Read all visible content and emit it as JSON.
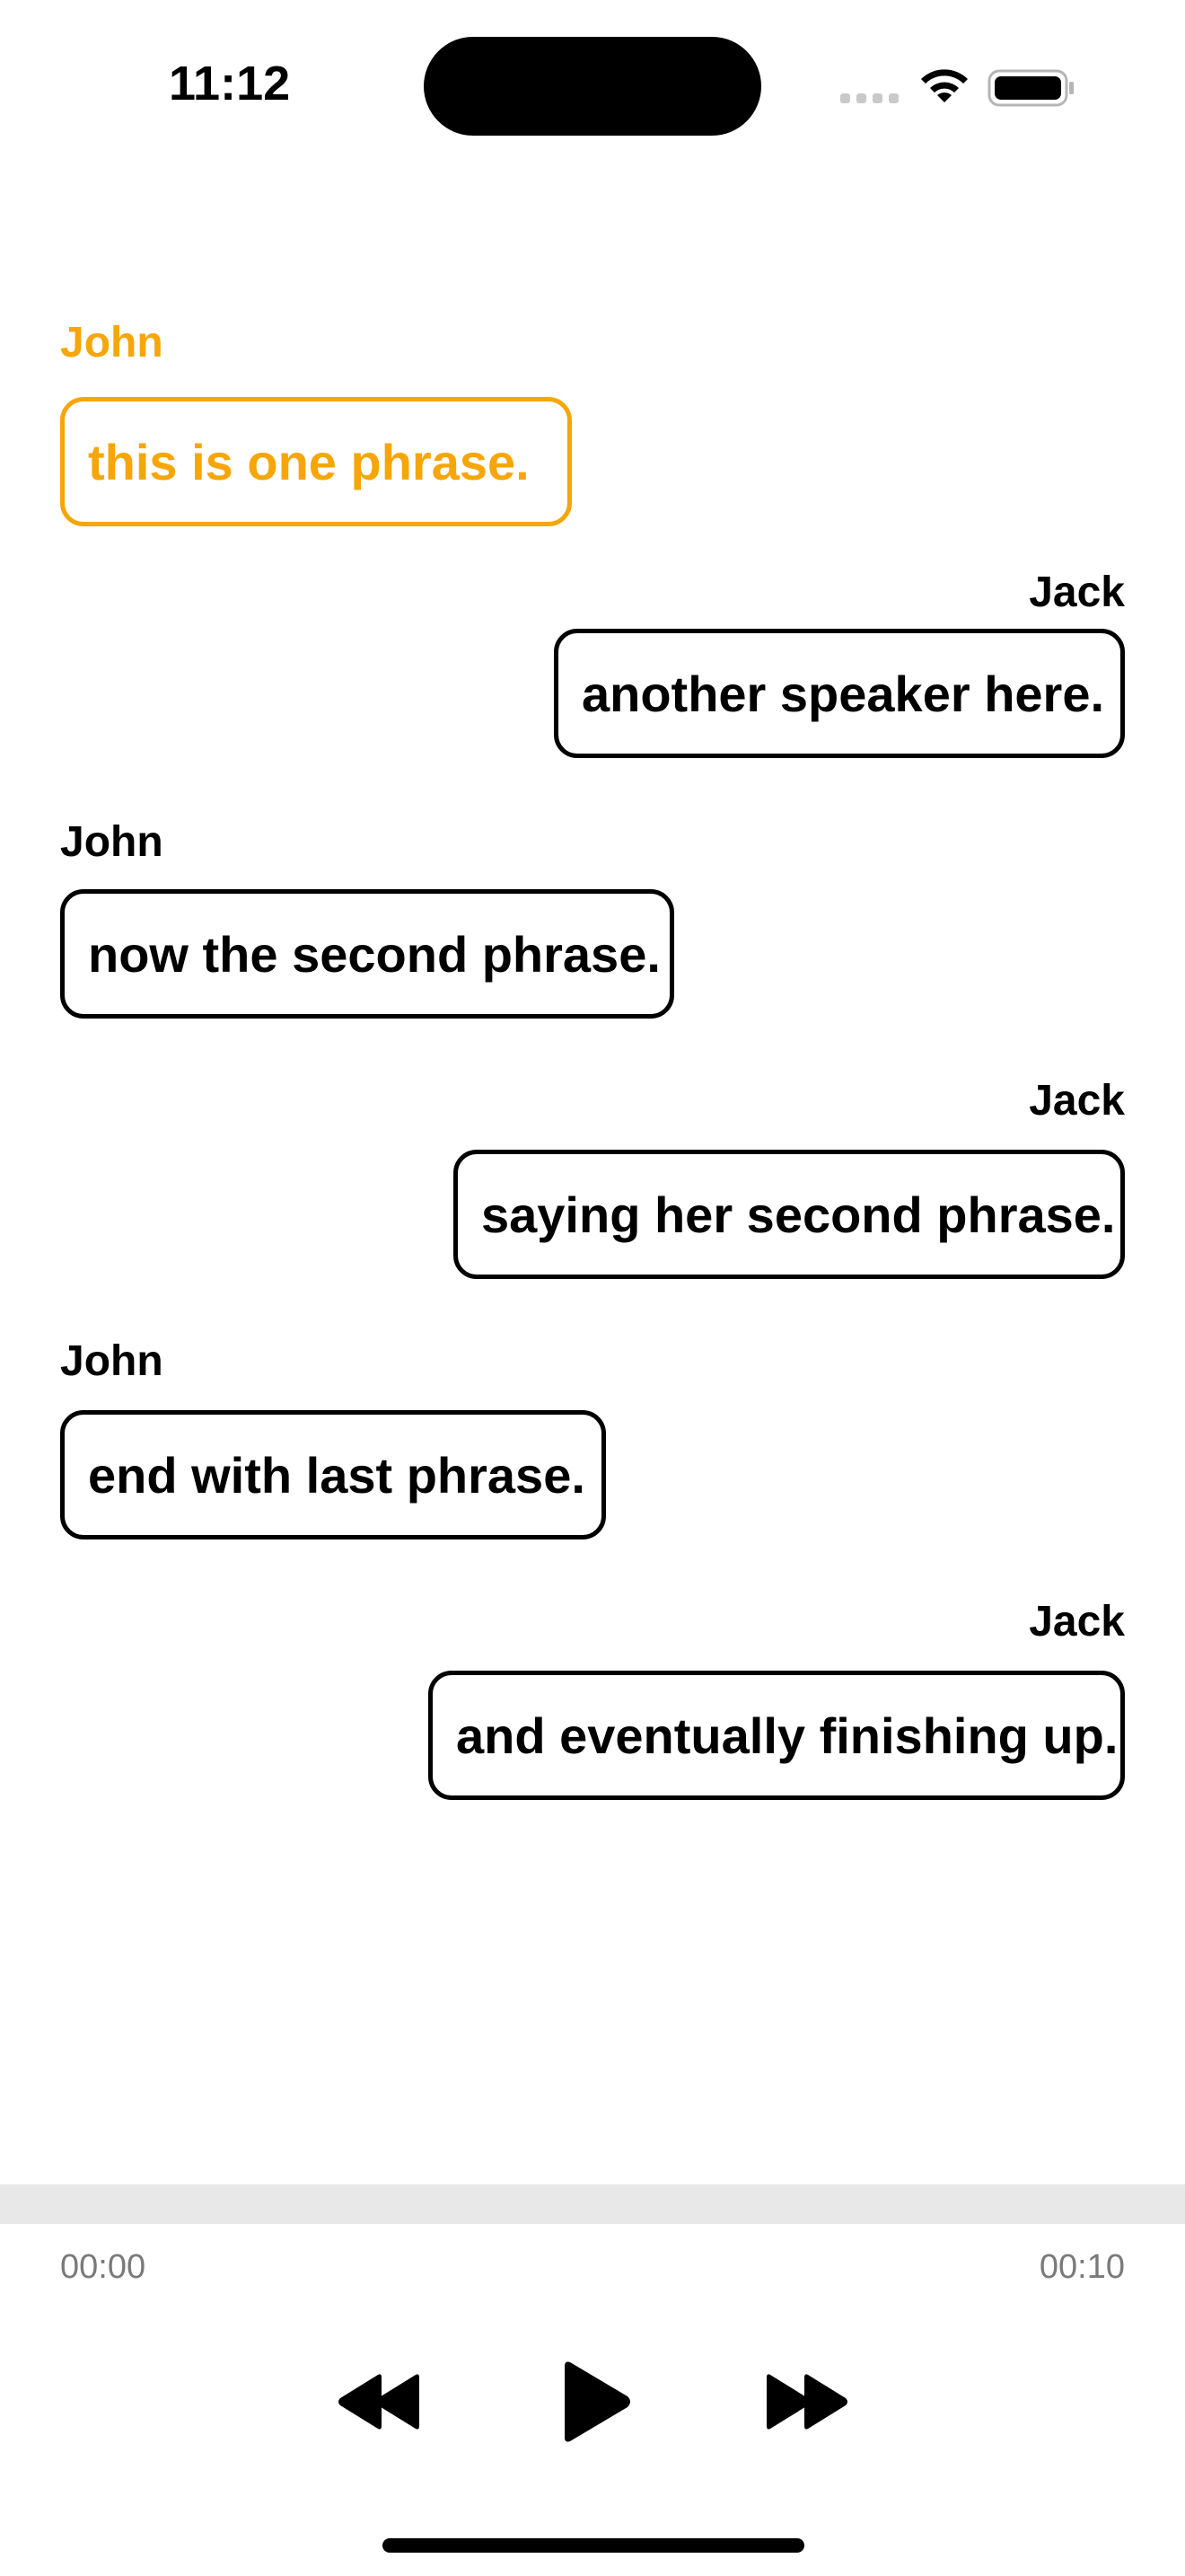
{
  "status_bar": {
    "time": "11:12",
    "icons": [
      "signal-icon",
      "wifi-icon",
      "battery-icon"
    ]
  },
  "transcript": {
    "active_color": "#f6a609",
    "messages": [
      {
        "speaker": "John",
        "text": "this is one phrase.",
        "side": "left",
        "active": true
      },
      {
        "speaker": "Jack",
        "text": "another speaker here.",
        "side": "right",
        "active": false
      },
      {
        "speaker": "John",
        "text": "now the second phrase.",
        "side": "left",
        "active": false
      },
      {
        "speaker": "Jack",
        "text": "saying her second phrase.",
        "side": "right",
        "active": false
      },
      {
        "speaker": "John",
        "text": "end with last phrase.",
        "side": "left",
        "active": false
      },
      {
        "speaker": "Jack",
        "text": "and eventually finishing up.",
        "side": "right",
        "active": false
      }
    ]
  },
  "player": {
    "current_time": "00:00",
    "total_time": "00:10",
    "progress": 0,
    "controls": [
      "rewind-icon",
      "play-icon",
      "fast-forward-icon"
    ]
  }
}
